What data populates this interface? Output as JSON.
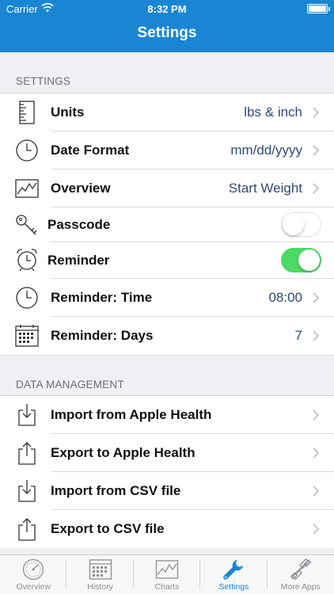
{
  "status_bar": {
    "carrier": "Carrier",
    "time": "8:32 PM"
  },
  "nav": {
    "title": "Settings"
  },
  "settings_section": {
    "header": "SETTINGS",
    "rows": [
      {
        "label": "Units",
        "value": "lbs & inch",
        "icon": "ruler-icon"
      },
      {
        "label": "Date Format",
        "value": "mm/dd/yyyy",
        "icon": "clock-icon"
      },
      {
        "label": "Overview",
        "value": "Start Weight",
        "icon": "line-chart-icon"
      },
      {
        "label": "Passcode",
        "icon": "key-icon",
        "toggle": false
      },
      {
        "label": "Reminder",
        "icon": "alarm-clock-icon",
        "toggle": true
      },
      {
        "label": "Reminder: Time",
        "value": "08:00",
        "icon": "clock-icon"
      },
      {
        "label": "Reminder: Days",
        "value": "7",
        "icon": "calendar-icon"
      }
    ]
  },
  "data_section": {
    "header": "DATA MANAGEMENT",
    "rows": [
      {
        "label": "Import from Apple Health",
        "icon": "import-icon"
      },
      {
        "label": "Export to Apple Health",
        "icon": "export-icon"
      },
      {
        "label": "Import from CSV file",
        "icon": "import-icon"
      },
      {
        "label": "Export to CSV file",
        "icon": "export-icon"
      }
    ]
  },
  "tabbar": {
    "tabs": [
      {
        "label": "Overview",
        "icon": "speedometer-icon",
        "active": false
      },
      {
        "label": "History",
        "icon": "calendar-icon",
        "active": false
      },
      {
        "label": "Charts",
        "icon": "line-chart-icon",
        "active": false
      },
      {
        "label": "Settings",
        "icon": "wrench-icon",
        "active": true
      },
      {
        "label": "More Apps",
        "icon": "dumbbell-icon",
        "active": false
      }
    ]
  },
  "colors": {
    "accent": "#1a86d3",
    "toggle_on": "#4cd964",
    "value_text": "#2e4a74",
    "background": "#efeff4"
  }
}
